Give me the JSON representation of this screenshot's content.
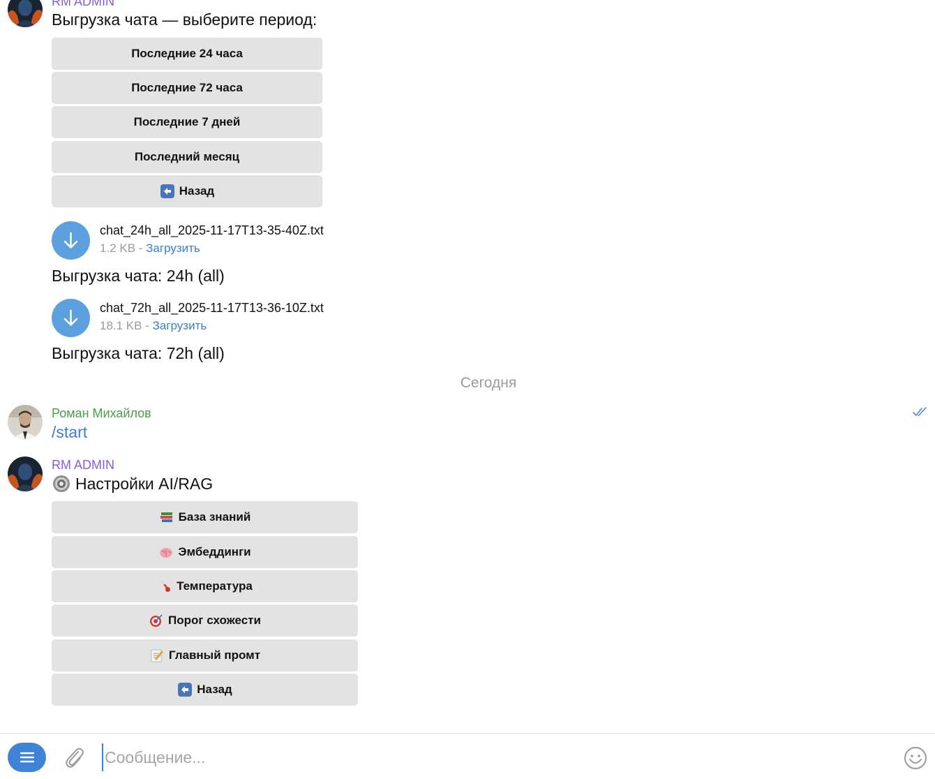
{
  "messages": {
    "export_prompt": {
      "sender": "RM ADMIN",
      "text": "Выгрузка чата — выберите период:",
      "buttons": [
        {
          "label": "Последние 24 часа",
          "icon": ""
        },
        {
          "label": "Последние 72 часа",
          "icon": ""
        },
        {
          "label": "Последние 7 дней",
          "icon": ""
        },
        {
          "label": "Последний месяц",
          "icon": ""
        },
        {
          "label": "Назад",
          "icon": "back-arrow-icon"
        }
      ]
    },
    "file1": {
      "name": "chat_24h_all_2025-11-17T13-35-40Z.txt",
      "size": "1.2 KB",
      "separator": " - ",
      "action": "Загрузить",
      "caption": "Выгрузка чата: 24h (all)"
    },
    "file2": {
      "name": "chat_72h_all_2025-11-17T13-36-10Z.txt",
      "size": "18.1 KB",
      "separator": " - ",
      "action": "Загрузить",
      "caption": "Выгрузка чата: 72h (all)"
    },
    "date_separator": "Сегодня",
    "user_message": {
      "sender": "Роман Михайлов",
      "text": "/start"
    },
    "settings": {
      "sender": "RM ADMIN",
      "text": "Настройки AI/RAG",
      "icon": "gear-icon",
      "buttons": [
        {
          "label": "База знаний",
          "icon": "books-icon"
        },
        {
          "label": "Эмбеддинги",
          "icon": "brain-icon"
        },
        {
          "label": "Температура",
          "icon": "thermometer-icon"
        },
        {
          "label": "Порог схожести",
          "icon": "target-icon"
        },
        {
          "label": "Главный промт",
          "icon": "memo-icon"
        },
        {
          "label": "Назад",
          "icon": "back-arrow-icon"
        }
      ]
    }
  },
  "composer": {
    "placeholder": "Сообщение...",
    "menu_icon": "hamburger-icon",
    "attach_icon": "paperclip-icon",
    "emoji_icon": "smiley-icon"
  },
  "colors": {
    "admin_name": "#8b5bd6",
    "user_name": "#4a9e4a",
    "link": "#3a7fd0",
    "button_bg": "#e3e3e3",
    "file_circle": "#5da0e0",
    "menu_button": "#3f83d6"
  }
}
